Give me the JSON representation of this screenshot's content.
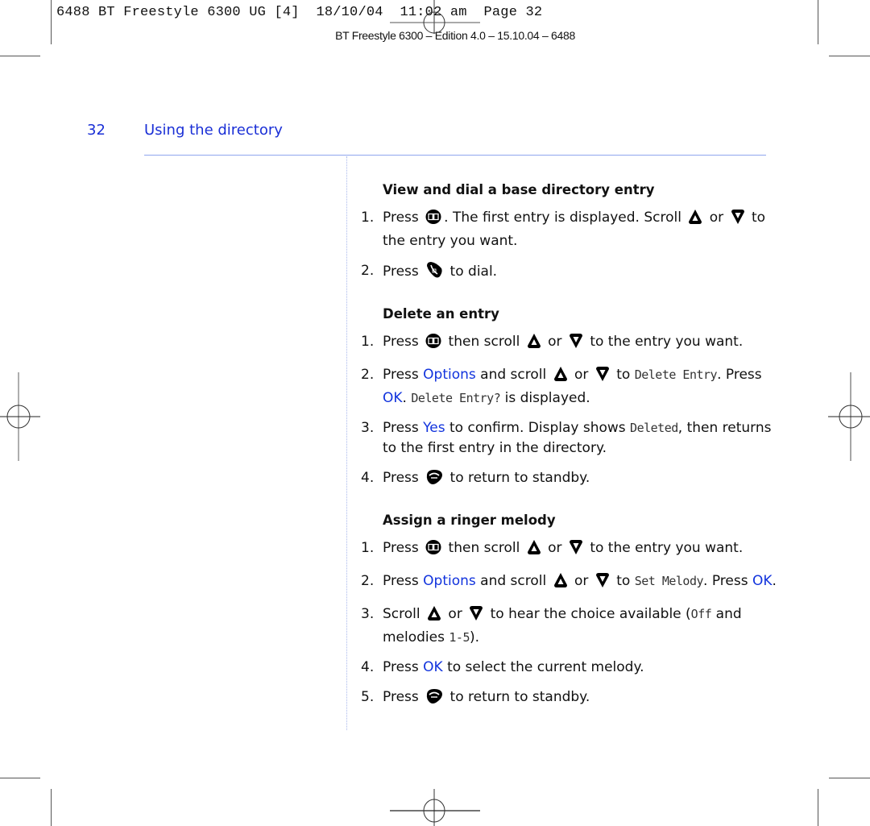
{
  "print_slug": {
    "text": "6488 BT Freestyle 6300 UG [4]  18/10/04  11:02 am  Page 32",
    "edition": "BT Freestyle 6300 – Edition 4.0 – 15.10.04 – 6488"
  },
  "header": {
    "page_number": "32",
    "section_title": "Using the directory"
  },
  "colors": {
    "accent_blue": "#1133dd",
    "rule_blue": "#8fa6ee"
  },
  "sections": [
    {
      "title": "View and dial a base directory entry",
      "steps": [
        {
          "num": "1.",
          "parts": [
            {
              "t": "Press "
            },
            {
              "icon": "directory-book-icon"
            },
            {
              "t": ". The first entry is displayed. Scroll "
            },
            {
              "icon": "scroll-up-icon"
            },
            {
              "t": " or "
            },
            {
              "icon": "scroll-down-icon"
            },
            {
              "t": " to the entry you want."
            }
          ]
        },
        {
          "num": "2.",
          "parts": [
            {
              "t": "Press "
            },
            {
              "icon": "talk-icon"
            },
            {
              "t": " to dial."
            }
          ]
        }
      ]
    },
    {
      "title": "Delete an entry",
      "steps": [
        {
          "num": "1.",
          "parts": [
            {
              "t": "Press "
            },
            {
              "icon": "directory-book-icon"
            },
            {
              "t": " then scroll "
            },
            {
              "icon": "scroll-up-icon"
            },
            {
              "t": " or "
            },
            {
              "icon": "scroll-down-icon"
            },
            {
              "t": " to the entry you want."
            }
          ]
        },
        {
          "num": "2.",
          "parts": [
            {
              "t": "Press "
            },
            {
              "b": "Options"
            },
            {
              "t": " and scroll "
            },
            {
              "icon": "scroll-up-icon"
            },
            {
              "t": " or "
            },
            {
              "icon": "scroll-down-icon"
            },
            {
              "t": " to "
            },
            {
              "lcd": "Delete Entry"
            },
            {
              "t": ". Press "
            },
            {
              "b": "OK"
            },
            {
              "t": ". "
            },
            {
              "lcd": "Delete Entry?"
            },
            {
              "t": " is displayed."
            }
          ]
        },
        {
          "num": "3.",
          "parts": [
            {
              "t": "Press "
            },
            {
              "b": "Yes"
            },
            {
              "t": " to confirm. Display shows "
            },
            {
              "lcd": "Deleted"
            },
            {
              "t": ", then returns to the first entry in the directory."
            }
          ]
        },
        {
          "num": "4.",
          "parts": [
            {
              "t": "Press "
            },
            {
              "icon": "end-call-icon"
            },
            {
              "t": " to return to standby."
            }
          ]
        }
      ]
    },
    {
      "title": "Assign a ringer melody",
      "steps": [
        {
          "num": "1.",
          "parts": [
            {
              "t": "Press "
            },
            {
              "icon": "directory-book-icon"
            },
            {
              "t": " then scroll "
            },
            {
              "icon": "scroll-up-icon"
            },
            {
              "t": " or "
            },
            {
              "icon": "scroll-down-icon"
            },
            {
              "t": " to the entry you want."
            }
          ]
        },
        {
          "num": "2.",
          "parts": [
            {
              "t": "Press "
            },
            {
              "b": "Options"
            },
            {
              "t": " and scroll "
            },
            {
              "icon": "scroll-up-icon"
            },
            {
              "t": " or "
            },
            {
              "icon": "scroll-down-icon"
            },
            {
              "t": " to "
            },
            {
              "lcd": "Set Melody"
            },
            {
              "t": ". Press "
            },
            {
              "b": "OK"
            },
            {
              "t": "."
            }
          ]
        },
        {
          "num": "3.",
          "parts": [
            {
              "t": "Scroll "
            },
            {
              "icon": "scroll-up-icon"
            },
            {
              "t": " or "
            },
            {
              "icon": "scroll-down-icon"
            },
            {
              "t": " to hear the choice available ("
            },
            {
              "lcd": "Off"
            },
            {
              "t": " and melodies "
            },
            {
              "lcd": "1-5"
            },
            {
              "t": ")."
            }
          ]
        },
        {
          "num": "4.",
          "parts": [
            {
              "t": "Press "
            },
            {
              "b": "OK"
            },
            {
              "t": " to select the current melody."
            }
          ]
        },
        {
          "num": "5.",
          "parts": [
            {
              "t": "Press "
            },
            {
              "icon": "end-call-icon"
            },
            {
              "t": " to return to standby."
            }
          ]
        }
      ]
    }
  ]
}
